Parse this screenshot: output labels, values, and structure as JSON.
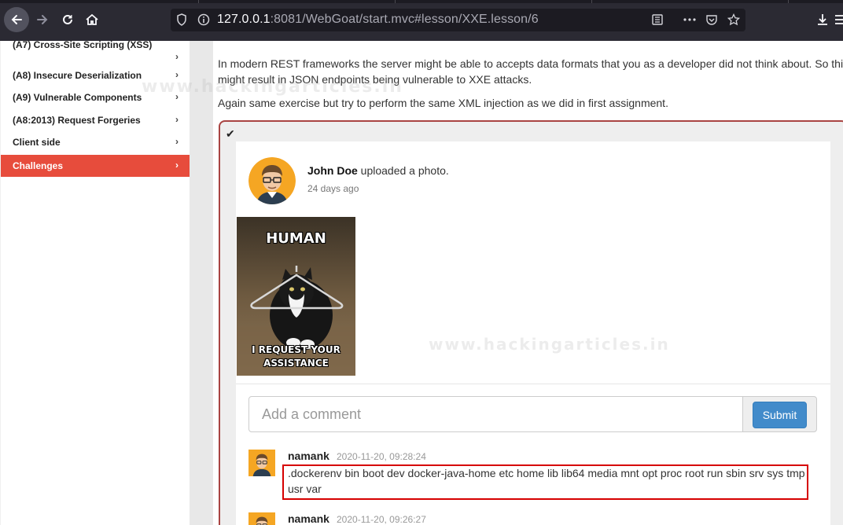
{
  "browser": {
    "url_host": "127.0.0.1",
    "url_rest": ":8081/WebGoat/start.mvc#lesson/XXE.lesson/6"
  },
  "sidebar": {
    "items": [
      {
        "label": "(A7) Cross-Site Scripting (XSS)"
      },
      {
        "label": "(A8) Insecure Deserialization"
      },
      {
        "label": "(A9) Vulnerable Components"
      },
      {
        "label": "(A8:2013) Request Forgeries"
      },
      {
        "label": "Client side"
      },
      {
        "label": "Challenges"
      }
    ],
    "chevron": "›"
  },
  "lesson": {
    "para1_line1": "In modern REST frameworks the server might be able to accepts data formats that you as a developer did not think about. So this",
    "para1_line2": "might result in JSON endpoints being vulnerable to XXE attacks.",
    "para2": "Again same exercise but try to perform the same XML injection as we did in first assignment."
  },
  "post": {
    "check": "✔",
    "author": "John Doe",
    "action": " uploaded a photo.",
    "ago": "24 days ago",
    "photo_top_caption": "HUMAN",
    "photo_bottom_caption_1": "I REQUEST YOUR",
    "photo_bottom_caption_2": "ASSISTANCE"
  },
  "comment_form": {
    "placeholder": "Add a comment",
    "submit_label": "Submit"
  },
  "comments": [
    {
      "user": "namank",
      "date": "2020-11-20, 09:28:24",
      "text": ".dockerenv bin boot dev docker-java-home etc home lib lib64 media mnt opt proc root run sbin srv sys tmp usr var"
    },
    {
      "user": "namank",
      "date": "2020-11-20, 09:26:27",
      "text": ""
    }
  ],
  "watermark": "www.hackingarticles.in",
  "colors": {
    "accent_active": "#e74c3c",
    "assignment_border": "#a94442",
    "submit": "#428bca",
    "highlight_box": "#d60000"
  }
}
